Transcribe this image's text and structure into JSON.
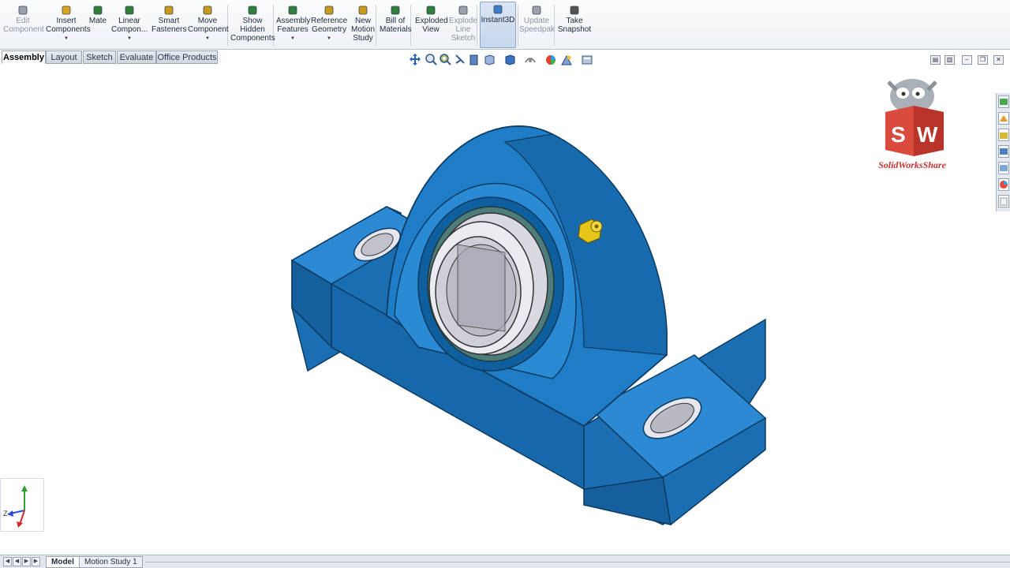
{
  "ribbon": {
    "commands": [
      {
        "label": "Edit\nComponent",
        "icon": "edit-component-icon",
        "disabled": true,
        "dropdown": false
      },
      {
        "label": "Insert\nComponents",
        "icon": "insert-components-icon",
        "disabled": false,
        "dropdown": true
      },
      {
        "label": "Mate",
        "icon": "mate-icon",
        "disabled": false,
        "dropdown": false
      },
      {
        "label": "Linear\nCompon...",
        "icon": "linear-pattern-icon",
        "disabled": false,
        "dropdown": true
      },
      {
        "label": "Smart\nFasteners",
        "icon": "smart-fasteners-icon",
        "disabled": false,
        "dropdown": false
      },
      {
        "label": "Move\nComponent",
        "icon": "move-component-icon",
        "disabled": false,
        "dropdown": true
      },
      {
        "label": "Show\nHidden\nComponents",
        "icon": "show-hidden-icon",
        "disabled": false,
        "dropdown": false
      },
      {
        "label": "Assembly\nFeatures",
        "icon": "assembly-features-icon",
        "disabled": false,
        "dropdown": true
      },
      {
        "label": "Reference\nGeometry",
        "icon": "reference-geometry-icon",
        "disabled": false,
        "dropdown": true
      },
      {
        "label": "New\nMotion\nStudy",
        "icon": "motion-study-icon",
        "disabled": false,
        "dropdown": false
      },
      {
        "label": "Bill of\nMaterials",
        "icon": "bill-of-materials-icon",
        "disabled": false,
        "dropdown": false
      },
      {
        "label": "Exploded\nView",
        "icon": "exploded-view-icon",
        "disabled": false,
        "dropdown": false
      },
      {
        "label": "Explode\nLine\nSketch",
        "icon": "explode-line-sketch-icon",
        "disabled": true,
        "dropdown": false
      },
      {
        "label": "Instant3D",
        "icon": "instant3d-icon",
        "disabled": false,
        "dropdown": false,
        "active": true
      },
      {
        "label": "Update\nSpeedpak",
        "icon": "update-speedpak-icon",
        "disabled": true,
        "dropdown": false
      },
      {
        "label": "Take\nSnapshot",
        "icon": "take-snapshot-icon",
        "disabled": false,
        "dropdown": false
      }
    ]
  },
  "tabs": [
    {
      "label": "Assembly",
      "active": true
    },
    {
      "label": "Layout",
      "active": false
    },
    {
      "label": "Sketch",
      "active": false
    },
    {
      "label": "Evaluate",
      "active": false
    },
    {
      "label": "Office Products",
      "active": false
    }
  ],
  "bottom_tabs": [
    {
      "label": "Model",
      "active": true
    },
    {
      "label": "Motion Study 1",
      "active": false
    }
  ],
  "watermark": {
    "text": "SolidWorksShare",
    "logo": "SW"
  },
  "triad": {
    "x_label": "Z",
    "colors": {
      "x": "#d22b2b",
      "y": "#2fa52f",
      "z": "#2b4fd2"
    }
  },
  "colors": {
    "housing": "#1e7dc6",
    "housing_dark": "#0f5f9e",
    "bearing": "#c9c9d1",
    "fitting": "#e6c619"
  }
}
